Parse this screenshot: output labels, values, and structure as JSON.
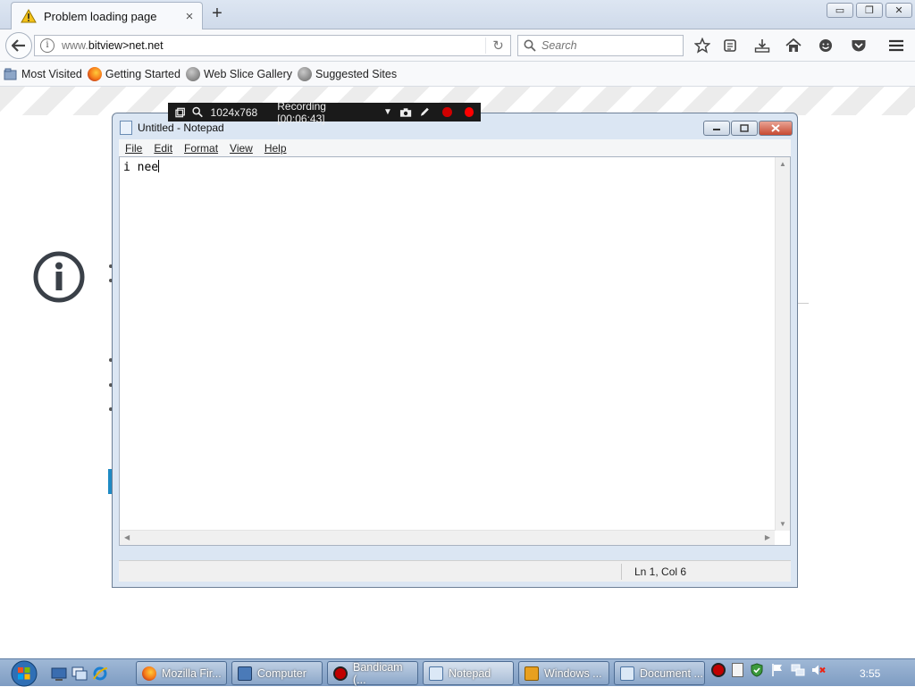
{
  "browser": {
    "tab": {
      "title": "Problem loading page",
      "close": "×"
    },
    "new_tab": "+",
    "window_buttons": {
      "minimize": "▭",
      "restore": "❐",
      "close": "✕"
    },
    "url": {
      "prefix": "www.",
      "main": "bitview>net.net"
    },
    "reload": "↻",
    "search": {
      "placeholder": "Search"
    },
    "bookmarks": [
      {
        "label": "Most Visited",
        "icon": "folder-icon"
      },
      {
        "label": "Getting Started",
        "icon": "firefox-icon"
      },
      {
        "label": "Web Slice Gallery",
        "icon": "globe-icon"
      },
      {
        "label": "Suggested Sites",
        "icon": "globe-icon"
      }
    ]
  },
  "recorder": {
    "resolution": "1024x768",
    "status": "Recording [00:06:43]"
  },
  "notepad": {
    "title": "Untitled - Notepad",
    "menu": {
      "file": "File",
      "edit": "Edit",
      "format": "Format",
      "view": "View",
      "help": "Help"
    },
    "text": "i nee",
    "status": "Ln 1, Col 6"
  },
  "taskbar": {
    "tasks": [
      {
        "label": "Mozilla Fir...",
        "icon": "firefox-icon",
        "color": "#e66000"
      },
      {
        "label": "Computer",
        "icon": "computer-icon",
        "color": "#4a7ab8"
      },
      {
        "label": "Bandicam (...",
        "icon": "bandicam-icon",
        "color": "#c00000"
      },
      {
        "label": "Notepad",
        "icon": "notepad-icon",
        "color": "#dbe8f6"
      },
      {
        "label": "Windows ...",
        "icon": "media-player-icon",
        "color": "#e8a020"
      },
      {
        "label": "Document ...",
        "icon": "document-icon",
        "color": "#dbe8f6"
      }
    ],
    "clock": "3:55"
  }
}
